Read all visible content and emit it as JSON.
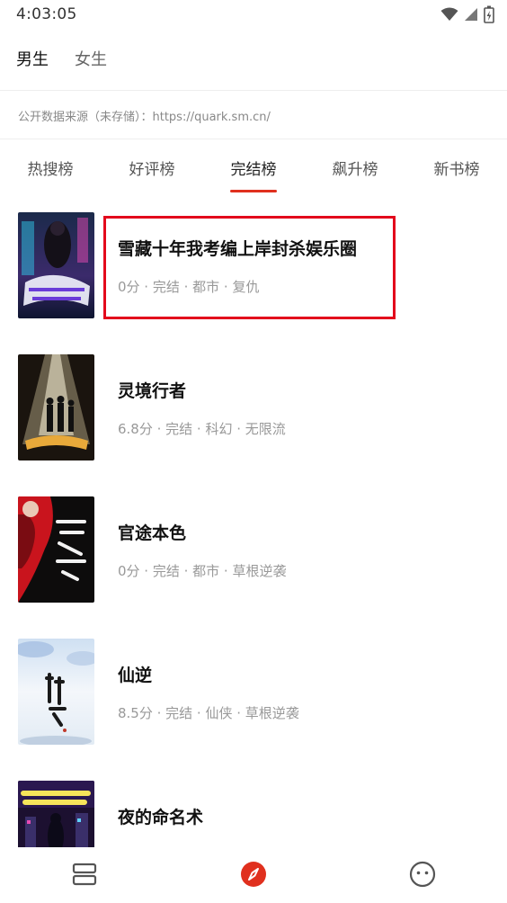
{
  "status_bar": {
    "time": "4:03:05"
  },
  "gender_tabs": [
    {
      "label": "男生",
      "active": true
    },
    {
      "label": "女生",
      "active": false
    }
  ],
  "source_note": "公开数据来源（未存储）：https://quark.sm.cn/",
  "rank_tabs": [
    {
      "label": "热搜榜",
      "active": false
    },
    {
      "label": "好评榜",
      "active": false
    },
    {
      "label": "完结榜",
      "active": true
    },
    {
      "label": "飙升榜",
      "active": false
    },
    {
      "label": "新书榜",
      "active": false
    }
  ],
  "books": [
    {
      "title": "雪藏十年我考编上岸封杀娱乐圈",
      "meta": "0分 · 完结 · 都市 · 复仇"
    },
    {
      "title": "灵境行者",
      "meta": "6.8分 · 完结 · 科幻 · 无限流"
    },
    {
      "title": "官途本色",
      "meta": "0分 · 完结 · 都市 · 草根逆袭"
    },
    {
      "title": "仙逆",
      "meta": "8.5分 · 完结 · 仙侠 · 草根逆袭"
    },
    {
      "title": "夜的命名术",
      "meta": ""
    }
  ],
  "colors": {
    "accent": "#e0301e",
    "highlight": "#e3081c"
  },
  "bottom_nav": [
    {
      "icon": "bookshelf-icon"
    },
    {
      "icon": "compass-icon",
      "active": true
    },
    {
      "icon": "profile-face-icon"
    }
  ]
}
